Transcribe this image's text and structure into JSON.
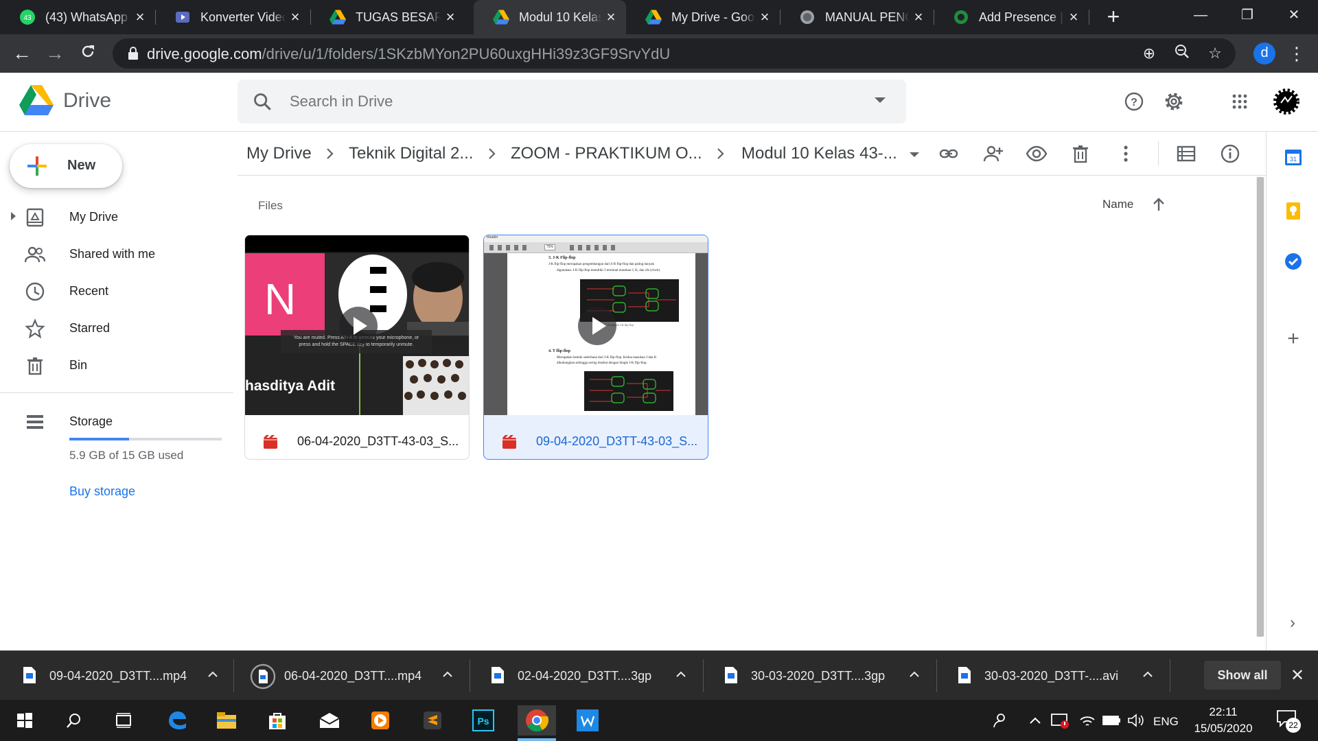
{
  "tabs": [
    {
      "title": "(43) WhatsApp",
      "badge": "43"
    },
    {
      "title": "Konverter Video"
    },
    {
      "title": "TUGAS BESAR P"
    },
    {
      "title": "Modul 10 Kelas"
    },
    {
      "title": "My Drive - Goog"
    },
    {
      "title": "MANUAL PENGU"
    },
    {
      "title": "Add Presence | S"
    }
  ],
  "address": {
    "host": "drive.google.com",
    "path": "/drive/u/1/folders/1SKzbMYon2PU60uxgHHi39z3GF9SrvYdU"
  },
  "profile_initial": "d",
  "drive": {
    "name": "Drive",
    "search_placeholder": "Search in Drive"
  },
  "sidebar": {
    "new_label": "New",
    "items": [
      {
        "label": "My Drive",
        "icon": "my-drive-icon"
      },
      {
        "label": "Shared with me",
        "icon": "people-icon"
      },
      {
        "label": "Recent",
        "icon": "clock-icon"
      },
      {
        "label": "Starred",
        "icon": "star-icon"
      },
      {
        "label": "Bin",
        "icon": "trash-icon"
      }
    ],
    "storage_label": "Storage",
    "storage_text": "5.9 GB of 15 GB used",
    "storage_fraction": 0.39,
    "buy_storage": "Buy storage"
  },
  "breadcrumb": [
    "My Drive",
    "Teknik Digital 2...",
    "ZOOM - PRAKTIKUM O...",
    "Modul 10 Kelas 43-..."
  ],
  "main": {
    "files_heading": "Files",
    "sort_label": "Name"
  },
  "files": [
    {
      "name": "06-04-2020_D3TT-43-03_S...",
      "thumb": {
        "letter": "N",
        "caption": "hasditya Adit",
        "muted1": "You are muted. Press Alt+A to unmute your microphone, or",
        "muted2": "press and hold the SPACE key to temporarily unmute."
      },
      "selected": false
    },
    {
      "name": "09-04-2020_D3TT-43-03_S...",
      "thumb": {
        "title": "Reader",
        "zoom": "75%",
        "h1": "3.  J-K Flip-flop",
        "p1a": "J-K flip-flop   merupakan pengembangan dari S-R flip-flop   dan paling banyak",
        "p1b": "digunakan. J-K flip-flop memiliki 3 terminal masukan J, K, dan clk (clock)",
        "cap1": "Gambar 1. Rangkaian J-K flip-flop",
        "h2": "4.  T flip-flop",
        "p2a": "Merupakan bentuk sederhana dari J-K flip-flop.   Kedua masukan J dan K",
        "p2b": "dihubungkan sehingga sering disebut dengan Single J-K flip-flop."
      },
      "selected": true
    }
  ],
  "downloads": [
    {
      "name": "09-04-2020_D3TT....mp4"
    },
    {
      "name": "06-04-2020_D3TT....mp4"
    },
    {
      "name": "02-04-2020_D3TT....3gp"
    },
    {
      "name": "30-03-2020_D3TT....3gp"
    },
    {
      "name": "30-03-2020_D3TT-....avi"
    }
  ],
  "show_all": "Show all",
  "taskbar": {
    "lang": "ENG",
    "time": "22:11",
    "date": "15/05/2020",
    "notif_count": "22"
  },
  "colors": {
    "brand_blue": "#1a73e8",
    "chrome_dark": "#202124",
    "selected_card": "#e8f0fe"
  }
}
